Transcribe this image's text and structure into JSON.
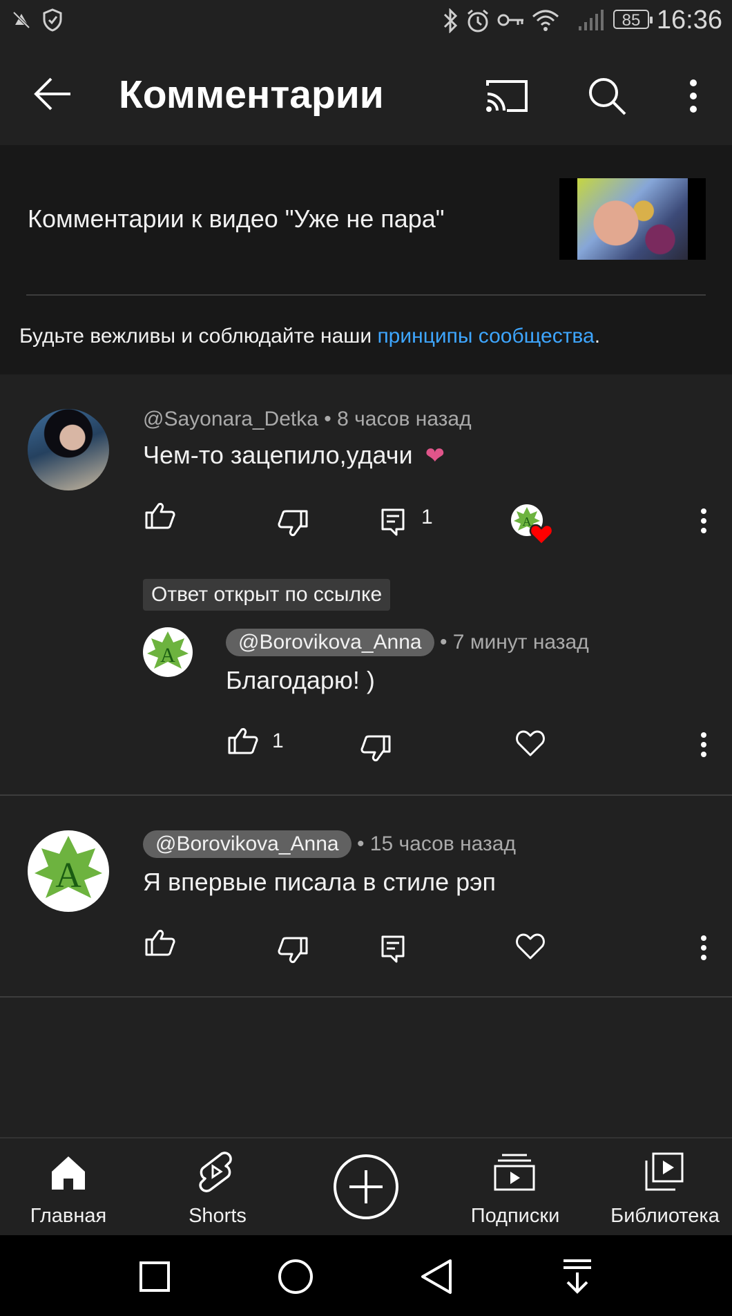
{
  "status_bar": {
    "time": "16:36",
    "battery": "85"
  },
  "app_bar": {
    "title": "Комментарии"
  },
  "header": {
    "video_title": "Комментарии к видео \"Уже не пара\"",
    "guidelines_prefix": "Будьте вежливы и соблюдайте наши ",
    "guidelines_link": "принципы сообщества",
    "guidelines_suffix": "."
  },
  "comments": [
    {
      "author": "@Sayonara_Detka",
      "time": "8 часов назад",
      "text": "Чем-то зацепило,удачи",
      "emoji": "❤",
      "replies_count": "1",
      "reply_badge": "Ответ открыт по ссылке",
      "reply": {
        "author": "@Borovikova_Anna",
        "time": "7 минут назад",
        "text": "Благодарю! )",
        "likes": "1"
      }
    },
    {
      "author": "@Borovikova_Anna",
      "time": "15 часов назад",
      "text": "Я впервые писала в стиле рэп"
    }
  ],
  "avatar_letter": "A",
  "bottom_nav": [
    {
      "label": "Главная",
      "icon": "home-icon"
    },
    {
      "label": "Shorts",
      "icon": "shorts-icon"
    },
    {
      "label": "",
      "icon": "create-icon"
    },
    {
      "label": "Подписки",
      "icon": "subscriptions-icon"
    },
    {
      "label": "Библиотека",
      "icon": "library-icon"
    }
  ],
  "colors": {
    "background": "#212121",
    "header_bg": "#181818",
    "link": "#3ea6ff",
    "heart": "#e0558a",
    "like_heart": "#ff0000"
  }
}
